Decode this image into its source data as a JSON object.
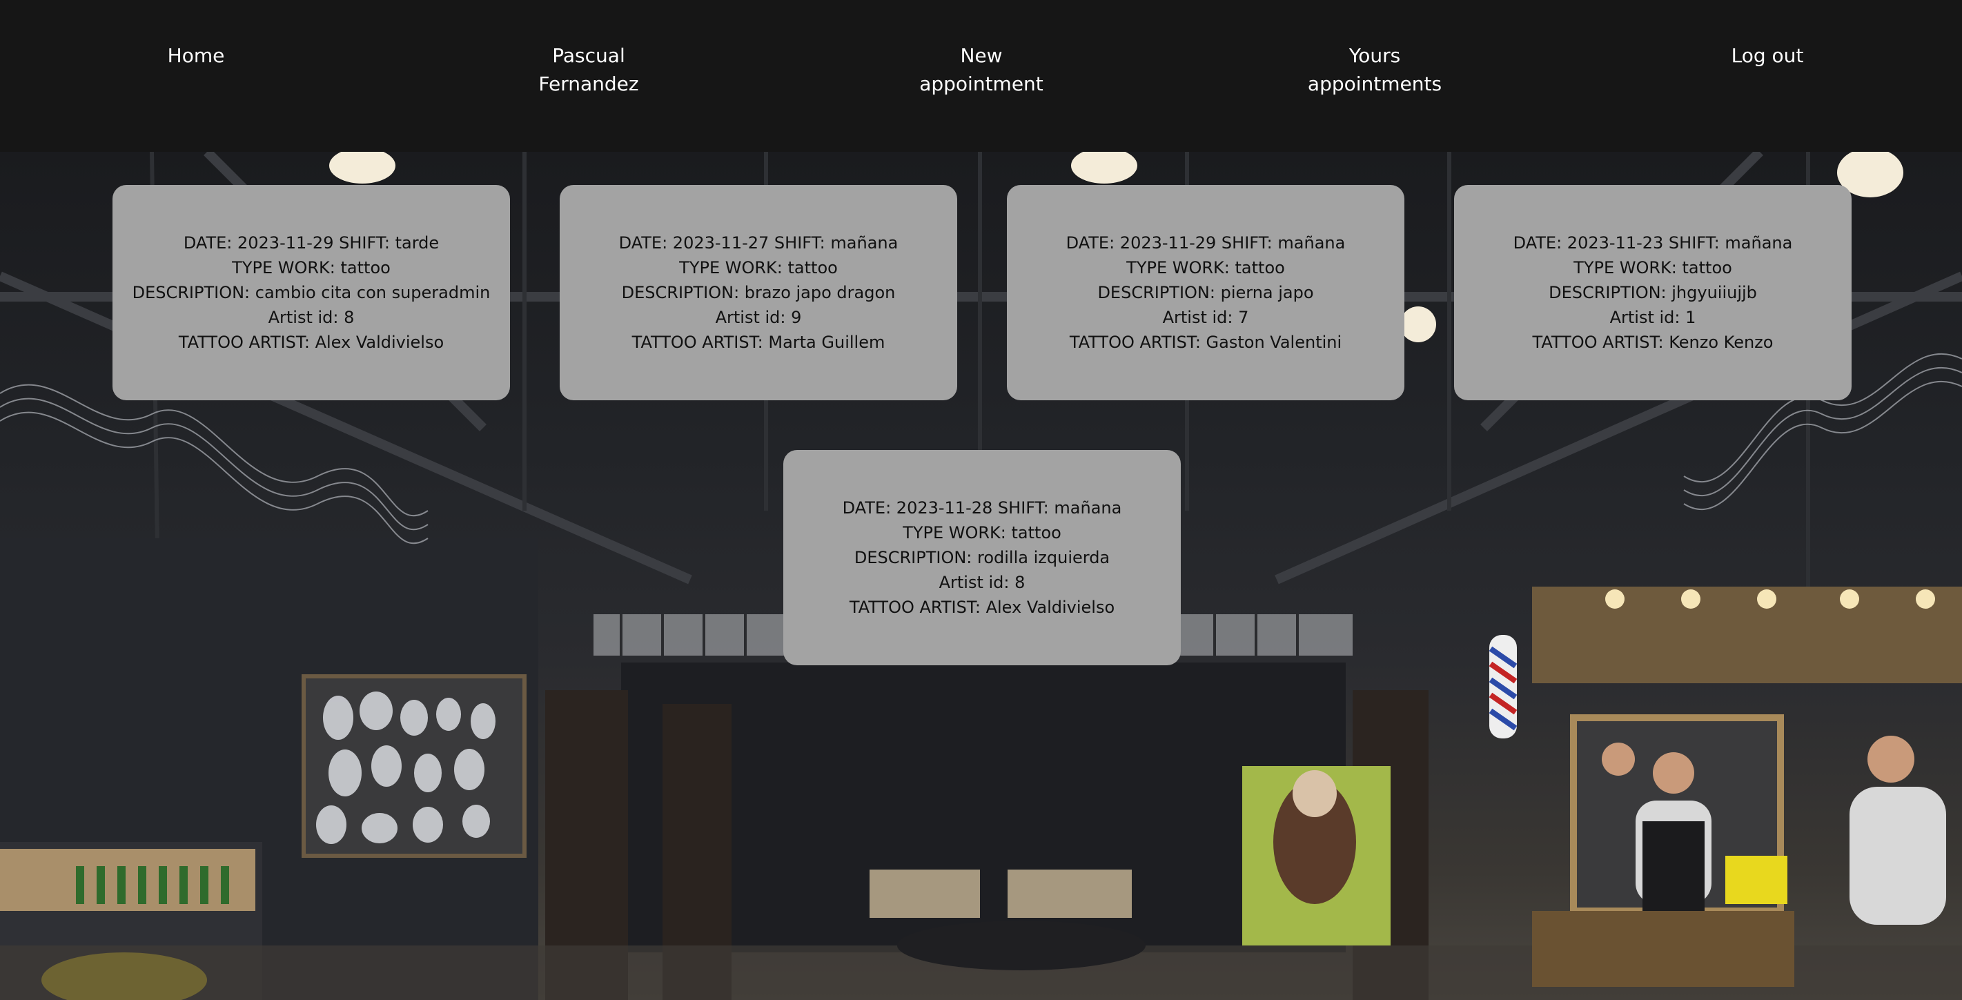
{
  "nav": {
    "home": "Home",
    "user": "Pascual\nFernandez",
    "new_appointment": "New\nappointment",
    "yours_appointments": "Yours\nappointments",
    "logout": "Log out"
  },
  "background": {
    "description_icon": "tattoo-studio-photo",
    "colors": {
      "navbar": "#161616",
      "card": "#a3a3a3",
      "nav_text": "#ffffff",
      "card_text": "#111111"
    }
  },
  "appointments": [
    {
      "date_shift": "DATE: 2023-11-29 SHIFT: tarde",
      "type_work": "TYPE WORK: tattoo",
      "description": "DESCRIPTION: cambio cita con superadmin",
      "artist_id": "Artist id: 8",
      "artist": "TATTOO ARTIST: Alex Valdivielso"
    },
    {
      "date_shift": "DATE: 2023-11-27 SHIFT: mañana",
      "type_work": "TYPE WORK: tattoo",
      "description": "DESCRIPTION: brazo japo dragon",
      "artist_id": "Artist id: 9",
      "artist": "TATTOO ARTIST: Marta Guillem"
    },
    {
      "date_shift": "DATE: 2023-11-29 SHIFT: mañana",
      "type_work": "TYPE WORK: tattoo",
      "description": "DESCRIPTION: pierna japo",
      "artist_id": "Artist id: 7",
      "artist": "TATTOO ARTIST: Gaston Valentini"
    },
    {
      "date_shift": "DATE: 2023-11-23 SHIFT: mañana",
      "type_work": "TYPE WORK: tattoo",
      "description": "DESCRIPTION: jhgyuiiujjb",
      "artist_id": "Artist id: 1",
      "artist": "TATTOO ARTIST: Kenzo Kenzo"
    },
    {
      "date_shift": "DATE: 2023-11-28 SHIFT: mañana",
      "type_work": "TYPE WORK: tattoo",
      "description": "DESCRIPTION: rodilla izquierda",
      "artist_id": "Artist id: 8",
      "artist": "TATTOO ARTIST: Alex Valdivielso"
    }
  ]
}
